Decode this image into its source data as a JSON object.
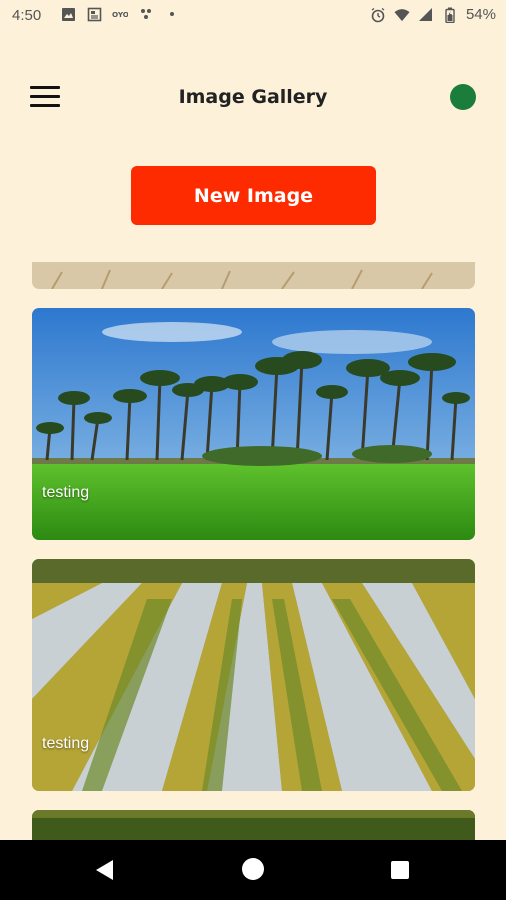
{
  "status_bar": {
    "time": "4:50",
    "battery": "54%",
    "left_icons": [
      "image-icon",
      "news-icon",
      "oyo-icon",
      "dots-icon",
      "dot-icon"
    ],
    "right_icons": [
      "alarm-icon",
      "wifi-icon",
      "signal-icon",
      "battery-icon"
    ]
  },
  "app_bar": {
    "title": "Image Gallery",
    "menu_icon": "hamburger-menu-icon",
    "status_indicator_color": "#1a7d3c"
  },
  "actions": {
    "new_image_label": "New Image",
    "accent_color": "#ff2b00"
  },
  "gallery": {
    "items": [
      {
        "label": ""
      },
      {
        "label": "testing"
      },
      {
        "label": "testing"
      },
      {
        "label": ""
      }
    ]
  },
  "nav_bar": {
    "back_icon": "back-icon",
    "home_icon": "home-icon",
    "recents_icon": "recents-icon"
  }
}
